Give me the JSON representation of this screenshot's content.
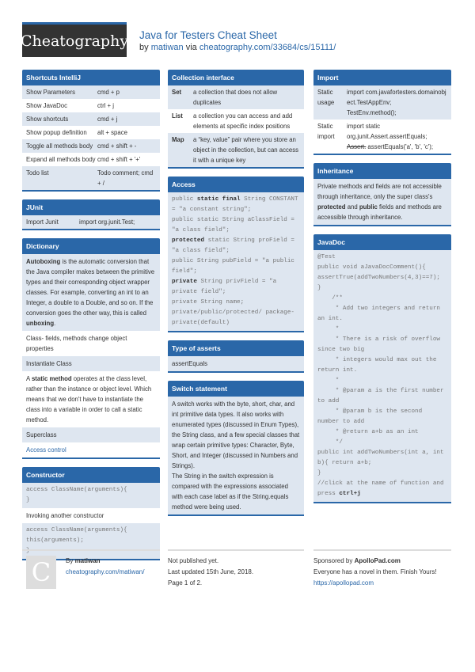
{
  "header": {
    "logo": "Cheatography",
    "title": "Java for Testers Cheat Sheet",
    "by": "by",
    "author": "matiwan",
    "via": "via",
    "url": "cheatography.com/33684/cs/15111/"
  },
  "shortcuts": {
    "title": "Shortcuts IntelliJ",
    "rows": [
      {
        "k": "Show Parameters",
        "v": "cmd + p"
      },
      {
        "k": "Show JavaDoc",
        "v": "ctrl + j"
      },
      {
        "k": "Show shortcuts",
        "v": "cmd + j"
      },
      {
        "k": "Show popup definition",
        "v": "alt + space"
      },
      {
        "k": "Toggle all methods body",
        "v": "cmd + shift + -"
      },
      {
        "k": "Expand all methods body",
        "v": "cmd + shift + '+'"
      },
      {
        "k": "Todo list",
        "v": "Todo comment; cmd + /"
      }
    ]
  },
  "junit": {
    "title": "JUnit",
    "rows": [
      {
        "k": "Import Junit",
        "v": "import org.junit.Test;"
      }
    ]
  },
  "dictionary": {
    "title": "Dictionary",
    "autoboxing_term": "Autoboxing",
    "autoboxing_text": " is the automatic conversion that the Java compiler makes between the primitive types and their corresponding object wrapper classes. For example, converting an int to an Integer, a double to a Double, and so on. If the conversion goes the other way, this is called ",
    "unboxing_term": "unboxing",
    "period": ".",
    "class_line": "Class- fields, methods change object properties",
    "instantiate": "Instantiate Class",
    "static_a": "A ",
    "static_term": "static method",
    "static_text": " operates at the class level, rather than the instance or object level. Which means that we don't have to instantiate the class into a variable in order to call a static method.",
    "superclass": "Superclass",
    "access_control": "Access control"
  },
  "constructor": {
    "title": "Constructor",
    "code1": "access ClassName(arguments){\n}",
    "invoking": "Invoking another constructor",
    "code2": "access ClassName(arguments){\nthis(arguments);\n}"
  },
  "collection": {
    "title": "Collection interface",
    "rows": [
      {
        "k": "Set",
        "v": "a collection that does not allow duplicates"
      },
      {
        "k": "List",
        "v": "a collection you can access and add elements at specific index positions"
      },
      {
        "k": "Map",
        "v": "a “key, value” pair where you store an object in the collection, but can access it with a unique key"
      }
    ]
  },
  "access": {
    "title": "Access",
    "l1a": "public ",
    "l1b": "static final",
    "l1c": " String CONSTANT = \"a constant string\";",
    "l2": "public static String aClassField = \"a class field\";",
    "l3a": "protected",
    "l3b": " static String proField = \"a class field\";",
    "l4": "public String pubField = \"a public field\";",
    "l5a": "private",
    "l5b": " String privField = \"a private field\";",
    "l6": "private String name;",
    "l7": "private/public/protected/ package-private(default)"
  },
  "asserts": {
    "title": "Type of asserts",
    "item": "assertEquals"
  },
  "switch": {
    "title": "Switch statement",
    "p1": "A switch works with the byte, short, char, and int primitive data types. It also works with enumerated types (discussed in Enum Types), the String class, and a few special classes that wrap certain primitive types: Character, Byte, Short, and Integer (discussed in Numbers and Strings).",
    "p2": "The String in the switch expression is compared with the expressions associated with each case label as if the String.equals method were being used."
  },
  "import": {
    "title": "Import",
    "r1k": "Static usage",
    "r1v": "import com.javafortesters.domainobject.TestAppEnv;\nTestEnv.method();",
    "r2k": "Static import",
    "r2v1": "import static org.junit.Assert.assertEquals;",
    "r2strike": "Assert.",
    "r2v2": " assertEquals('a', 'b', 'c');"
  },
  "inheritance": {
    "title": "Inheritance",
    "t1": "Private methods and fields are not accessible through inheritance, only the super class's ",
    "b1": "protected",
    "t2": " and ",
    "b2": "public",
    "t3": " fields and methods are accessible through inheritance."
  },
  "javadoc": {
    "title": "JavaDoc",
    "code": "@Test\npublic void aJavaDocComment(){\nassertTrue(addTwoNumbers(4,3)==7);\n}\n    /**\n     * Add two integers and return an int.\n     *\n     * There is a risk of overflow since two big\n     * integers would max out the return int.\n     *\n     * @param a is the first number to add\n     * @param b is the second number to add\n     * @return a+b as an int\n     */\npublic int addTwoNumbers(int a, int b){ return a+b;\n}\n//click at the name of function and press ",
    "bold": "ctrl+j"
  },
  "footer": {
    "avatar": "C",
    "by": "By ",
    "author": "matiwan",
    "author_url": "cheatography.com/matiwan/",
    "published": "Not published yet.",
    "updated": "Last updated 15th June, 2018.",
    "page": "Page 1 of 2.",
    "sponsored": "Sponsored by ",
    "sponsor": "ApolloPad.com",
    "tagline": "Everyone has a novel in them. Finish Yours!",
    "sponsor_url": "https://apollopad.com"
  }
}
